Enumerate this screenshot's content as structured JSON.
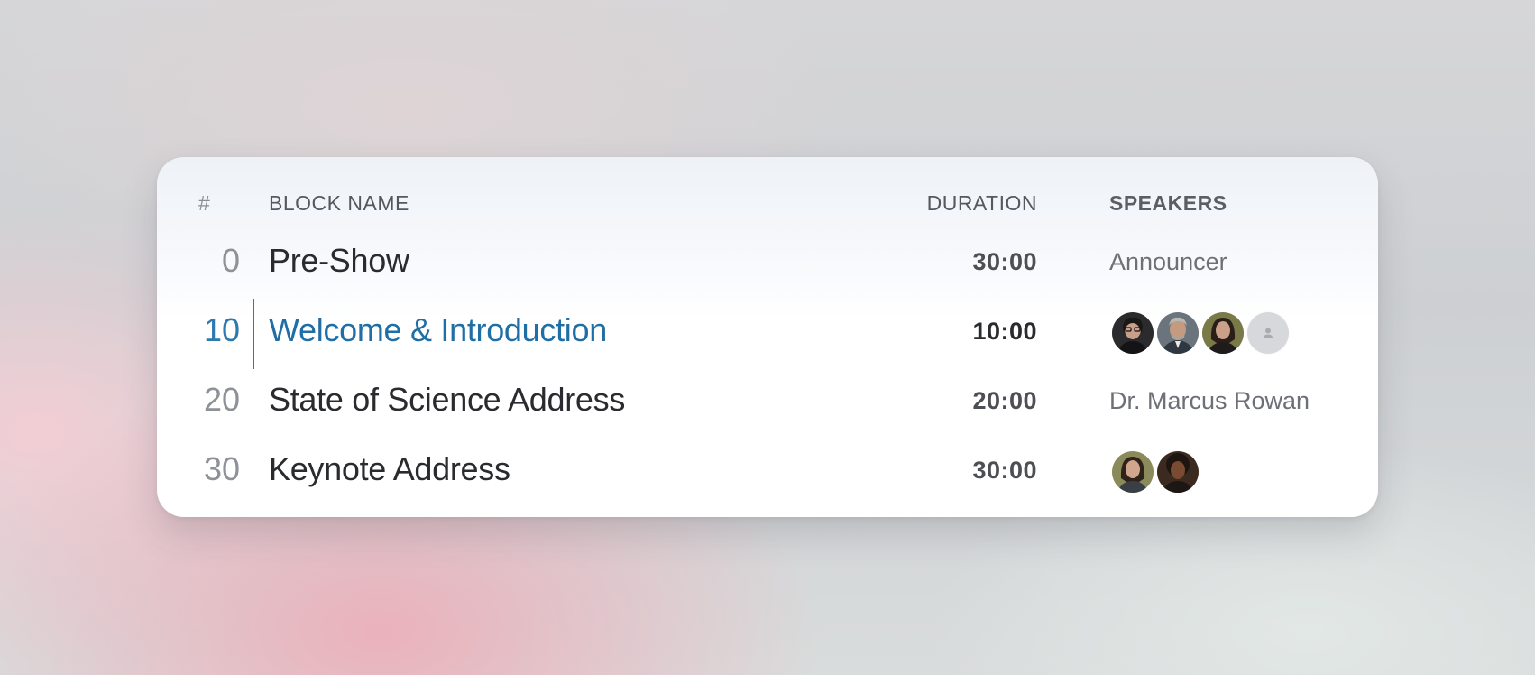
{
  "table": {
    "headers": {
      "number": "#",
      "block_name": "BLOCK NAME",
      "duration": "DURATION",
      "speakers": "SPEAKERS"
    },
    "rows": [
      {
        "number": "0",
        "block_name": "Pre-Show",
        "duration": "30:00",
        "speakers_text": "Announcer",
        "active": false
      },
      {
        "number": "10",
        "block_name": "Welcome & Introduction",
        "duration": "10:00",
        "speakers_avatars": [
          "avatar-woman-glasses",
          "avatar-man-gray-beard",
          "avatar-woman-dark-hair",
          "avatar-placeholder-person-icon"
        ],
        "active": true
      },
      {
        "number": "20",
        "block_name": "State of Science Address",
        "duration": "20:00",
        "speakers_text": "Dr. Marcus Rowan",
        "active": false
      },
      {
        "number": "30",
        "block_name": "Keynote Address",
        "duration": "30:00",
        "speakers_avatars": [
          "avatar-woman-dark-hair",
          "avatar-woman-curly-hair"
        ],
        "active": false
      }
    ]
  },
  "colors": {
    "accent": "#1f6ea6",
    "text_primary": "#2a2b2e",
    "text_muted": "#8e9298"
  }
}
